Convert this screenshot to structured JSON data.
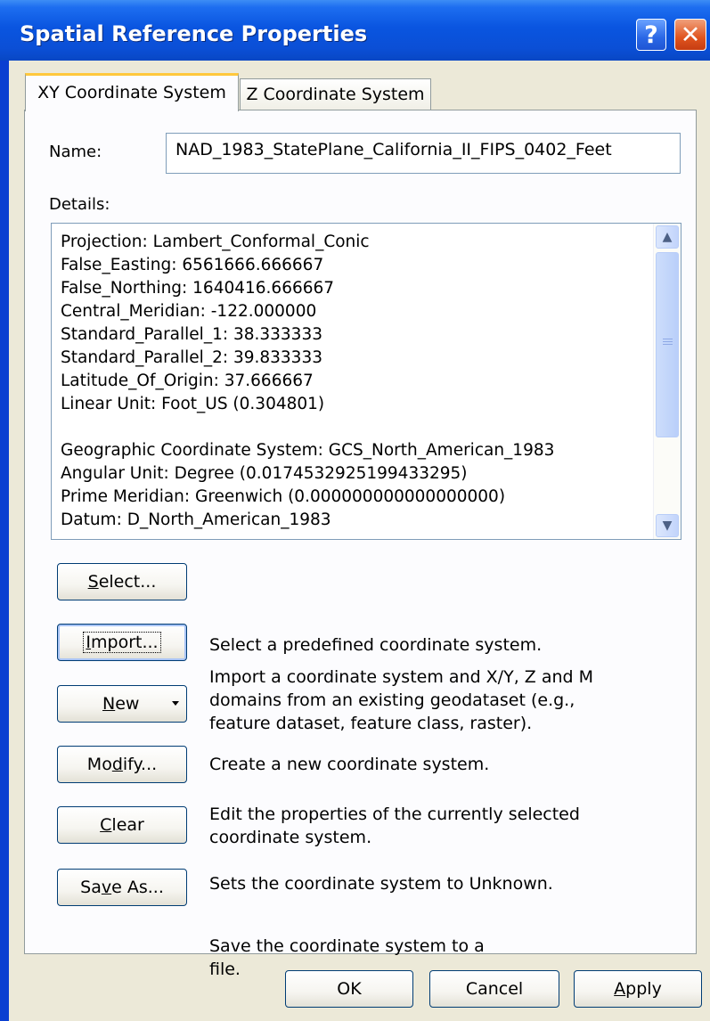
{
  "window": {
    "title": "Spatial Reference Properties",
    "help_label": "?",
    "close_label": "✕"
  },
  "tabs": [
    {
      "label": "XY Coordinate System",
      "active": true
    },
    {
      "label": "Z Coordinate System",
      "active": false
    }
  ],
  "name_field": {
    "label": "Name:",
    "value": "NAD_1983_StatePlane_California_II_FIPS_0402_Feet"
  },
  "details": {
    "label": "Details:",
    "lines": [
      "Projection: Lambert_Conformal_Conic",
      "False_Easting: 6561666.666667",
      "False_Northing: 1640416.666667",
      "Central_Meridian: -122.000000",
      "Standard_Parallel_1: 38.333333",
      "Standard_Parallel_2: 39.833333",
      "Latitude_Of_Origin: 37.666667",
      "Linear Unit: Foot_US (0.304801)",
      "",
      "Geographic Coordinate System: GCS_North_American_1983",
      "Angular Unit: Degree (0.0174532925199433295)",
      "Prime Meridian: Greenwich (0.000000000000000000)",
      "Datum: D_North_American_1983"
    ]
  },
  "actions": [
    {
      "label": "Select...",
      "mnemonic": "S",
      "rest": "elect...",
      "desc": [
        "Select a predefined coordinate system."
      ]
    },
    {
      "label": "Import...",
      "mnemonic": "I",
      "rest": "mport...",
      "desc": [
        "Import a coordinate system and X/Y, Z and M",
        "domains from an existing geodataset (e.g.,",
        "feature dataset, feature class, raster)."
      ]
    },
    {
      "label": "New",
      "mnemonic": "N",
      "rest": "ew",
      "desc": [
        "Create a new coordinate system."
      ]
    },
    {
      "label": "Modify...",
      "pre": "Mo",
      "mnemonic": "d",
      "rest": "ify...",
      "desc": [
        "Edit the properties of the currently selected",
        "coordinate system."
      ]
    },
    {
      "label": "Clear",
      "mnemonic": "C",
      "rest": "lear",
      "desc": [
        "Sets the coordinate system to Unknown."
      ]
    },
    {
      "label": "Save As...",
      "pre": "Sa",
      "mnemonic": "v",
      "rest": "e As...",
      "desc": [
        "Save the coordinate system to a",
        "file."
      ]
    }
  ],
  "footer": {
    "ok": "OK",
    "cancel": "Cancel",
    "apply_mnemonic": "A",
    "apply_rest": "pply"
  }
}
